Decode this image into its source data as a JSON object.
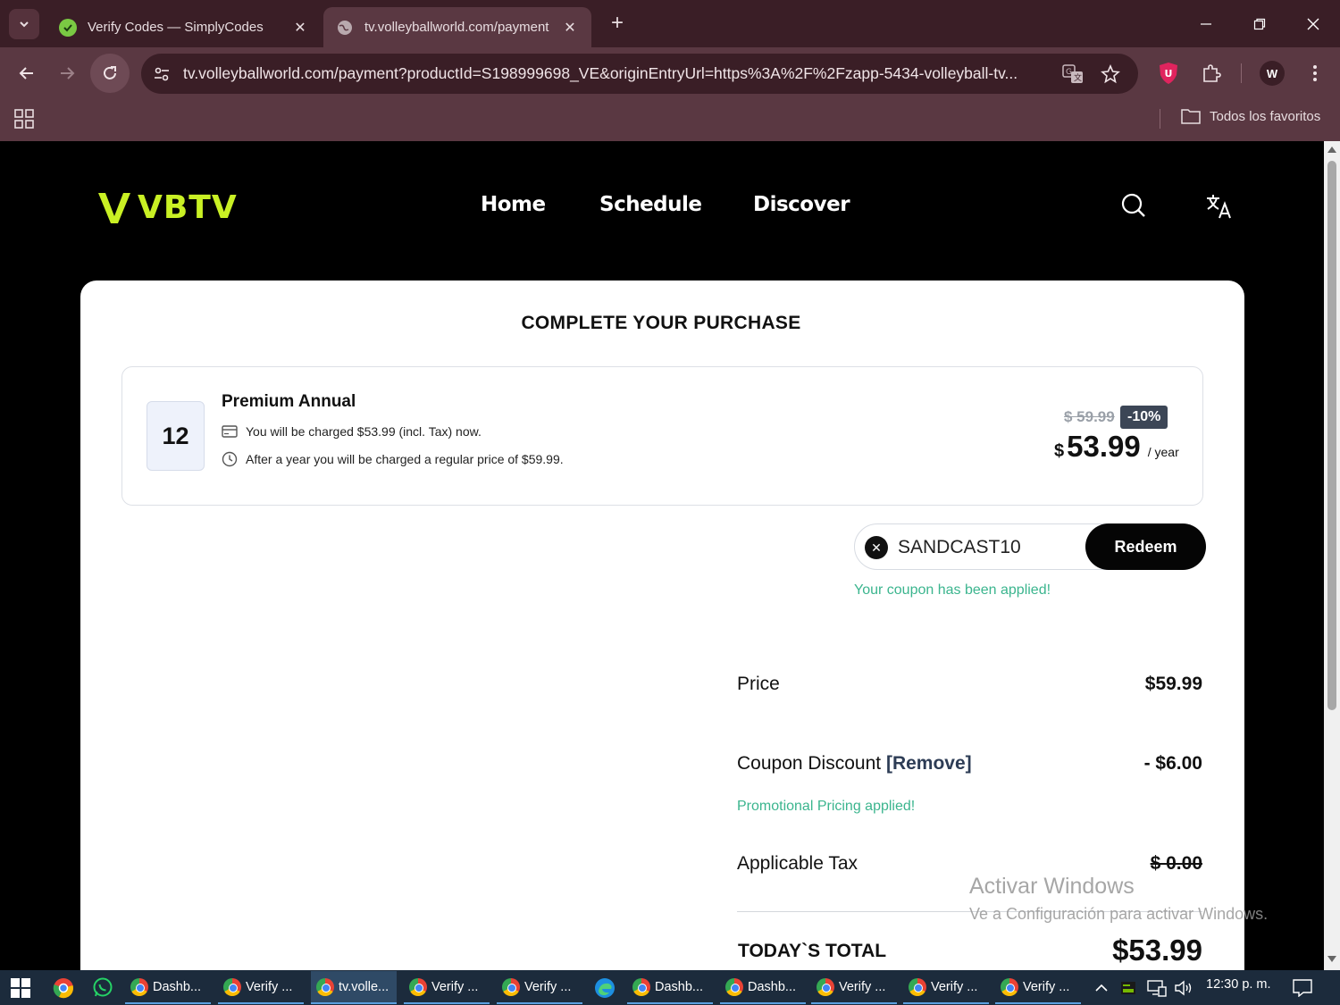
{
  "browser": {
    "tabs": [
      {
        "title": "Verify Codes — SimplyCodes",
        "active": false
      },
      {
        "title": "tv.volleyballworld.com/payment",
        "active": true
      }
    ],
    "url": "tv.volleyballworld.com/payment?productId=S198999698_VE&originEntryUrl=https%3A%2F%2Fzapp-5434-volleyball-tv...",
    "profile_initial": "W",
    "bookmarks_label": "Todos los favoritos",
    "ext_badge": "U"
  },
  "site": {
    "logo": "VBTV",
    "nav": [
      "Home",
      "Schedule",
      "Discover"
    ],
    "accent_color": "#c9f024"
  },
  "purchase": {
    "title": "COMPLETE YOUR PURCHASE",
    "plan": {
      "months": "12",
      "name": "Premium Annual",
      "charge_now": "You will be charged $53.99 (incl. Tax) now.",
      "renewal": "After a year you will be charged a regular price of $59.99.",
      "old_price": "$ 59.99",
      "discount": "-10%",
      "currency": "$",
      "price": "53.99",
      "period": "/ year"
    },
    "coupon": {
      "code": "SANDCAST10",
      "button": "Redeem",
      "message": "Your coupon has been applied!"
    },
    "summary": {
      "price_label": "Price",
      "price_value": "$59.99",
      "discount_label": "Coupon Discount",
      "remove_label": "[Remove]",
      "discount_value": "- $6.00",
      "promo_message": "Promotional Pricing applied!",
      "tax_label": "Applicable Tax",
      "tax_value": "$ 0.00",
      "total_label": "TODAY`S TOTAL",
      "total_value": "$53.99"
    }
  },
  "watermark": {
    "line1": "Activar Windows",
    "line2": "Ve a Configuración para activar Windows."
  },
  "taskbar": {
    "items": [
      "Dashb...",
      "Verify ...",
      "tv.volle...",
      "Verify ...",
      "Verify ...",
      "Dashb...",
      "Dashb...",
      "Verify ...",
      "Verify ...",
      "Verify ..."
    ],
    "time": "12:30 p. m."
  }
}
